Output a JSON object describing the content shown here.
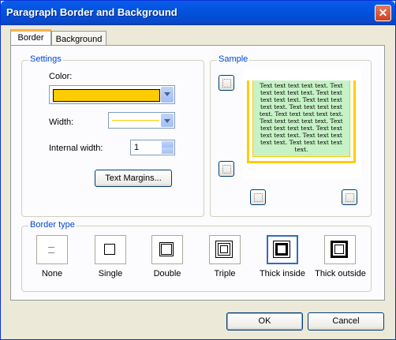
{
  "window": {
    "title": "Paragraph Border and Background",
    "close_glyph": "✕"
  },
  "tabs": [
    {
      "label": "Border",
      "active": true
    },
    {
      "label": "Background",
      "active": false
    }
  ],
  "settings": {
    "group_label": "Settings",
    "color_label": "Color:",
    "color_value": "#ffcc00",
    "width_label": "Width:",
    "internal_width_label": "Internal width:",
    "internal_width_value": "1",
    "text_margins_button": "Text Margins..."
  },
  "sample": {
    "group_label": "Sample",
    "text": "Text text text text text. Text text text text text. Text text text text text. Text text text text text. Text text text text text. Text text text text text. Text text text text text. Text text text text text. Text text text text text. Text text text text text. Text text text text text.",
    "fill_color": "#c6f2c6",
    "border_color": "#ffcc00"
  },
  "border_type": {
    "group_label": "Border type",
    "options": [
      {
        "label": "None",
        "icon": "border-none-icon"
      },
      {
        "label": "Single",
        "icon": "border-single-icon"
      },
      {
        "label": "Double",
        "icon": "border-double-icon"
      },
      {
        "label": "Triple",
        "icon": "border-triple-icon"
      },
      {
        "label": "Thick inside",
        "icon": "border-thick-inside-icon",
        "selected": true
      },
      {
        "label": "Thick outside",
        "icon": "border-thick-outside-icon"
      }
    ]
  },
  "footer": {
    "ok": "OK",
    "cancel": "Cancel"
  }
}
